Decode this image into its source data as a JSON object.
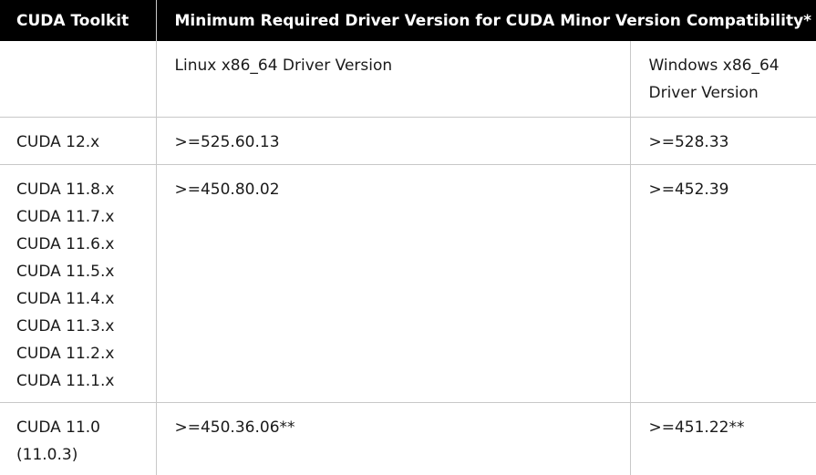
{
  "header": {
    "toolkit": "CUDA Toolkit",
    "min_driver": "Minimum Required Driver Version for CUDA Minor Version Compatibility*"
  },
  "subheader": {
    "linux": "Linux x86_64 Driver Version",
    "windows_line1": "Windows x86_64",
    "windows_line2": "Driver Version"
  },
  "rows": [
    {
      "toolkit": [
        "CUDA 12.x"
      ],
      "linux": ">=525.60.13",
      "windows": ">=528.33"
    },
    {
      "toolkit": [
        "CUDA 11.8.x",
        "CUDA 11.7.x",
        "CUDA 11.6.x",
        "CUDA 11.5.x",
        "CUDA 11.4.x",
        "CUDA 11.3.x",
        "CUDA 11.2.x",
        "CUDA 11.1.x"
      ],
      "linux": ">=450.80.02",
      "windows": ">=452.39"
    },
    {
      "toolkit": [
        "CUDA 11.0",
        "(11.0.3)"
      ],
      "linux": ">=450.36.06**",
      "windows": ">=451.22**"
    }
  ]
}
